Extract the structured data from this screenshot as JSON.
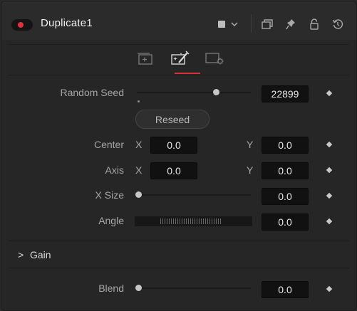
{
  "header": {
    "title": "Duplicate1",
    "icons": [
      "power-toggle",
      "color-swatch",
      "chevron-down",
      "version-box",
      "pin",
      "lock",
      "reset"
    ]
  },
  "tabs": [
    {
      "name": "image-tab",
      "active": false
    },
    {
      "name": "controls-tab",
      "active": true
    },
    {
      "name": "settings-tab",
      "active": false
    }
  ],
  "controls": {
    "random_seed": {
      "label": "Random Seed",
      "value": "22899",
      "slider_fraction": 0.68
    },
    "reseed_label": "Reseed",
    "center": {
      "label": "Center",
      "x_label": "X",
      "x_value": "0.0",
      "y_label": "Y",
      "y_value": "0.0"
    },
    "axis": {
      "label": "Axis",
      "x_label": "X",
      "x_value": "0.0",
      "y_label": "Y",
      "y_value": "0.0"
    },
    "x_size": {
      "label": "X Size",
      "value": "0.0",
      "slider_fraction": 0.0
    },
    "angle": {
      "label": "Angle",
      "value": "0.0"
    },
    "gain": {
      "label": "Gain",
      "chevron": ">"
    },
    "blend": {
      "label": "Blend",
      "value": "0.0",
      "slider_fraction": 0.0
    }
  },
  "colors": {
    "accent": "#d8333a",
    "power": "#e5303a"
  }
}
